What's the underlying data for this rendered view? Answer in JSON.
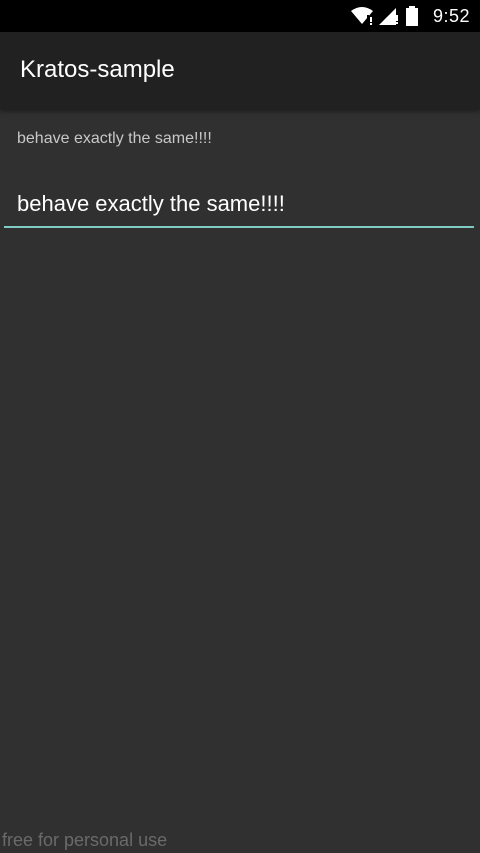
{
  "status_bar": {
    "time": "9:52",
    "icons": [
      "wifi-icon",
      "signal-icon",
      "battery-icon"
    ]
  },
  "app_bar": {
    "title": "Kratos-sample"
  },
  "content": {
    "echo_text": "behave exactly the same!!!!",
    "edit_text_value": "behave exactly the same!!!!"
  },
  "watermark": "free for personal use",
  "colors": {
    "background": "#303030",
    "app_bar": "#212121",
    "status_bar": "#000000",
    "accent_underline": "#80cbc4"
  }
}
